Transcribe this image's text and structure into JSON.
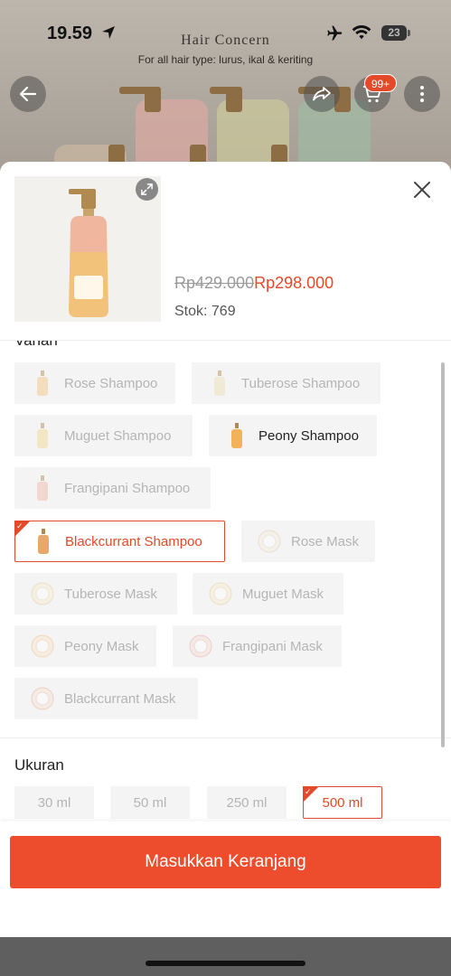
{
  "status_bar": {
    "time": "19.59",
    "battery": "23"
  },
  "background_page": {
    "banner_title": "Hair Concern",
    "banner_subtitle": "For all hair type: lurus, ikal & keriting",
    "cart_badge": "99+"
  },
  "product": {
    "original_price": "Rp429.000",
    "sale_price": "Rp298.000",
    "stock": "Stok: 769"
  },
  "variant_section": {
    "title": "Varian",
    "options": [
      {
        "label": "Rose Shampoo",
        "state": "disabled"
      },
      {
        "label": "Tuberose Shampoo",
        "state": "disabled"
      },
      {
        "label": "Muguet Shampoo",
        "state": "disabled"
      },
      {
        "label": "Peony Shampoo",
        "state": "available"
      },
      {
        "label": "Frangipani Shampoo",
        "state": "disabled"
      },
      {
        "label": "Blackcurrant Shampoo",
        "state": "selected"
      },
      {
        "label": "Rose Mask",
        "state": "disabled"
      },
      {
        "label": "Tuberose Mask",
        "state": "disabled"
      },
      {
        "label": "Muguet Mask",
        "state": "disabled"
      },
      {
        "label": "Peony Mask",
        "state": "disabled"
      },
      {
        "label": "Frangipani Mask",
        "state": "disabled"
      },
      {
        "label": "Blackcurrant Mask",
        "state": "disabled"
      }
    ]
  },
  "size_section": {
    "title": "Ukuran",
    "options": [
      {
        "label": "30 ml",
        "state": "disabled"
      },
      {
        "label": "50 ml",
        "state": "disabled"
      },
      {
        "label": "250 ml",
        "state": "disabled"
      },
      {
        "label": "500 ml",
        "state": "selected"
      }
    ]
  },
  "footer": {
    "add_to_cart_label": "Masukkan Keranjang"
  },
  "colors": {
    "accent": "#ee4d2d",
    "selected_text": "#e24a2a",
    "disabled_text": "#b5b5b5",
    "chip_bg": "#f4f4f4"
  }
}
